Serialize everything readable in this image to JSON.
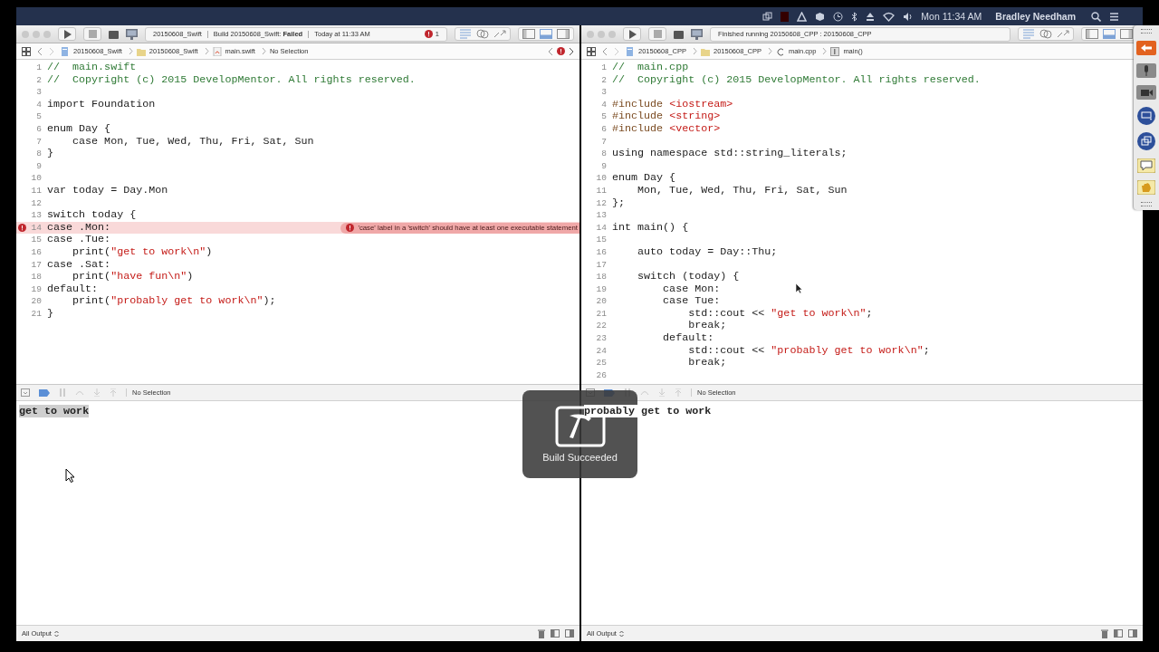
{
  "menu_bar": {
    "clock": "Mon 11:34 AM",
    "user": "Bradley Needham"
  },
  "windows": [
    {
      "toolbar": {
        "status": [
          "20150608_Swift",
          "Build 20150608_Swift: **Failed**",
          "Today at 11:33 AM"
        ],
        "issue_count": "1"
      },
      "jump_bar": {
        "crumbs": [
          {
            "kind": "project",
            "label": "20150608_Swift"
          },
          {
            "kind": "folder",
            "label": "20150608_Swift"
          },
          {
            "kind": "swift",
            "label": "main.swift"
          },
          {
            "kind": "plain",
            "label": "No Selection"
          }
        ],
        "issue_indicator": true
      },
      "editor": {
        "lines": [
          {
            "number": "1",
            "code": [
              {
                "kind": "comment",
                "text": "//  main.swift"
              }
            ]
          },
          {
            "number": "2",
            "code": [
              {
                "kind": "comment",
                "text": "//  Copyright (c) 2015 DevelopMentor. All rights reserved."
              }
            ]
          },
          {
            "number": "3"
          },
          {
            "number": "4",
            "code": [
              {
                "kind": "plain",
                "text": "import Foundation"
              }
            ]
          },
          {
            "number": "5"
          },
          {
            "number": "6",
            "code": [
              {
                "kind": "plain",
                "text": "enum Day {"
              }
            ]
          },
          {
            "number": "7",
            "code": [
              {
                "kind": "plain",
                "text": "    case Mon, Tue, Wed, Thu, Fri, Sat, Sun"
              }
            ]
          },
          {
            "number": "8",
            "code": [
              {
                "kind": "plain",
                "text": "}"
              }
            ]
          },
          {
            "number": "9"
          },
          {
            "number": "10"
          },
          {
            "number": "11",
            "code": [
              {
                "kind": "plain",
                "text": "var today = Day.Mon"
              }
            ]
          },
          {
            "number": "12"
          },
          {
            "number": "13",
            "code": [
              {
                "kind": "plain",
                "text": "switch today {"
              }
            ]
          },
          {
            "number": "14",
            "error": true,
            "code": [
              {
                "kind": "plain",
                "text": "case .Mon:"
              }
            ],
            "message": "'case' label in a 'switch' should have at least one executable statement"
          },
          {
            "number": "15",
            "code": [
              {
                "kind": "plain",
                "text": "case .Tue:"
              }
            ]
          },
          {
            "number": "16",
            "code": [
              {
                "kind": "plain",
                "text": "    print("
              },
              {
                "kind": "string",
                "text": "\"get to work\\n\""
              },
              {
                "kind": "plain",
                "text": ")"
              }
            ]
          },
          {
            "number": "17",
            "code": [
              {
                "kind": "plain",
                "text": "case .Sat:"
              }
            ]
          },
          {
            "number": "18",
            "code": [
              {
                "kind": "plain",
                "text": "    print("
              },
              {
                "kind": "string",
                "text": "\"have fun\\n\""
              },
              {
                "kind": "plain",
                "text": ")"
              }
            ]
          },
          {
            "number": "19",
            "code": [
              {
                "kind": "plain",
                "text": "default:"
              }
            ]
          },
          {
            "number": "20",
            "code": [
              {
                "kind": "plain",
                "text": "    print("
              },
              {
                "kind": "string",
                "text": "\"probably get to work\\n\""
              },
              {
                "kind": "plain",
                "text": ");"
              }
            ]
          },
          {
            "number": "21",
            "code": [
              {
                "kind": "plain",
                "text": "}"
              }
            ]
          }
        ]
      },
      "debug_bar": {
        "selection": "No Selection"
      },
      "console": {
        "output": "get to work",
        "highlighted": true
      },
      "output_filter": "All Output"
    },
    {
      "toolbar": {
        "status": [
          "Finished running 20150608_CPP : 20150608_CPP"
        ]
      },
      "jump_bar": {
        "crumbs": [
          {
            "kind": "project",
            "label": "20150608_CPP"
          },
          {
            "kind": "folder",
            "label": "20150608_CPP"
          },
          {
            "kind": "cpp",
            "label": "main.cpp"
          },
          {
            "kind": "function",
            "label": "main()"
          }
        ],
        "issue_indicator": false
      },
      "editor": {
        "lines": [
          {
            "number": "1",
            "code": [
              {
                "kind": "comment",
                "text": "//  main.cpp"
              }
            ]
          },
          {
            "number": "2",
            "code": [
              {
                "kind": "comment",
                "text": "//  Copyright (c) 2015 DevelopMentor. All rights reserved."
              }
            ]
          },
          {
            "number": "3"
          },
          {
            "number": "4",
            "code": [
              {
                "kind": "directive",
                "text": "#include "
              },
              {
                "kind": "string",
                "text": "<iostream>"
              }
            ]
          },
          {
            "number": "5",
            "code": [
              {
                "kind": "directive",
                "text": "#include "
              },
              {
                "kind": "string",
                "text": "<string>"
              }
            ]
          },
          {
            "number": "6",
            "code": [
              {
                "kind": "directive",
                "text": "#include "
              },
              {
                "kind": "string",
                "text": "<vector>"
              }
            ]
          },
          {
            "number": "7"
          },
          {
            "number": "8",
            "code": [
              {
                "kind": "plain",
                "text": "using namespace std::string_literals;"
              }
            ]
          },
          {
            "number": "9"
          },
          {
            "number": "10",
            "code": [
              {
                "kind": "plain",
                "text": "enum Day {"
              }
            ]
          },
          {
            "number": "11",
            "code": [
              {
                "kind": "plain",
                "text": "    Mon, Tue, Wed, Thu, Fri, Sat, Sun"
              }
            ]
          },
          {
            "number": "12",
            "code": [
              {
                "kind": "plain",
                "text": "};"
              }
            ]
          },
          {
            "number": "13"
          },
          {
            "number": "14",
            "code": [
              {
                "kind": "plain",
                "text": "int main() {"
              }
            ]
          },
          {
            "number": "15"
          },
          {
            "number": "16",
            "code": [
              {
                "kind": "plain",
                "text": "    auto today = Day::Thu;"
              }
            ]
          },
          {
            "number": "17"
          },
          {
            "number": "18",
            "code": [
              {
                "kind": "plain",
                "text": "    switch (today) {"
              }
            ]
          },
          {
            "number": "19",
            "code": [
              {
                "kind": "plain",
                "text": "        case Mon:"
              }
            ]
          },
          {
            "number": "20",
            "code": [
              {
                "kind": "plain",
                "text": "        case Tue:"
              }
            ]
          },
          {
            "number": "21",
            "code": [
              {
                "kind": "plain",
                "text": "            std::cout << "
              },
              {
                "kind": "string",
                "text": "\"get to work\\n\""
              },
              {
                "kind": "plain",
                "text": ";"
              }
            ]
          },
          {
            "number": "22",
            "code": [
              {
                "kind": "plain",
                "text": "            break;"
              }
            ]
          },
          {
            "number": "23",
            "code": [
              {
                "kind": "plain",
                "text": "        default:"
              }
            ]
          },
          {
            "number": "24",
            "code": [
              {
                "kind": "plain",
                "text": "            std::cout << "
              },
              {
                "kind": "string",
                "text": "\"probably get to work\\n\""
              },
              {
                "kind": "plain",
                "text": ";"
              }
            ]
          },
          {
            "number": "25",
            "code": [
              {
                "kind": "plain",
                "text": "            break;"
              }
            ]
          },
          {
            "number": "26"
          }
        ]
      },
      "debug_bar": {
        "selection": "No Selection"
      },
      "console": {
        "output": "probably get to work",
        "highlighted": false
      },
      "output_filter": "All Output"
    }
  ],
  "hud": {
    "text": "Build Succeeded"
  }
}
